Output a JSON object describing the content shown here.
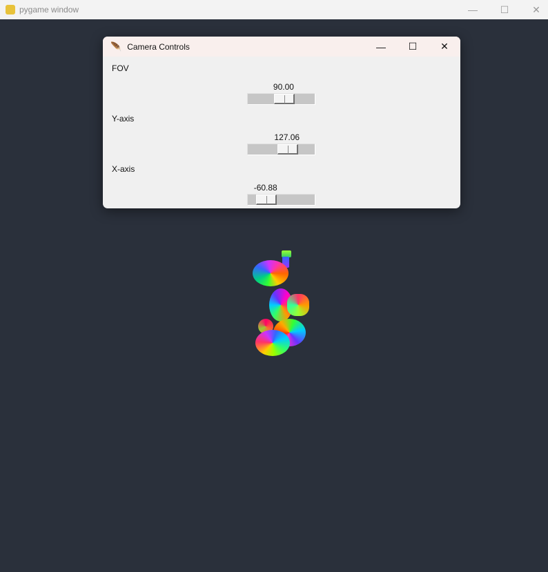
{
  "window": {
    "title": "pygame window",
    "icon": "pygame-snake-icon"
  },
  "dialog": {
    "title": "Camera Controls",
    "icon": "feather-icon",
    "sliders": [
      {
        "label": "FOV",
        "value": "90.00",
        "fraction": 0.55
      },
      {
        "label": "Y-axis",
        "value": "127.06",
        "fraction": 0.62
      },
      {
        "label": "X-axis",
        "value": "-60.88",
        "fraction": 0.17
      }
    ]
  },
  "colors": {
    "background": "#2a303b",
    "dialog": "#f0f0f0",
    "dialog_titlebar": "#f9efed"
  }
}
